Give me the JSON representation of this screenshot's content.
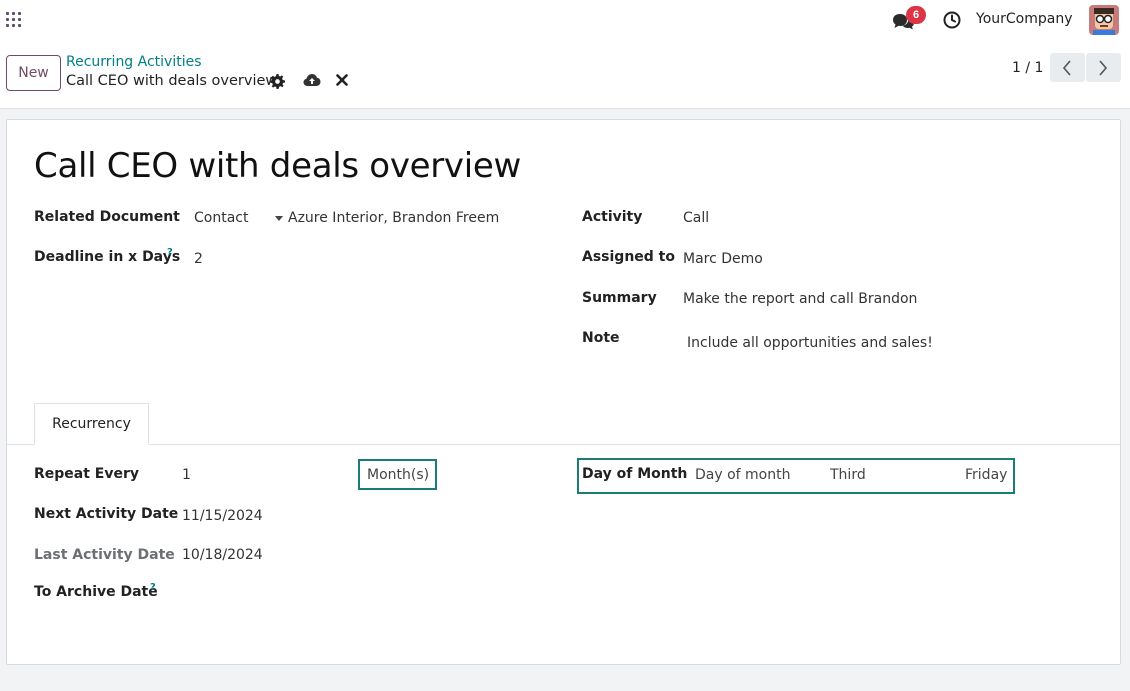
{
  "header": {
    "notification_count": "6",
    "company": "YourCompany"
  },
  "controls": {
    "new_label": "New",
    "breadcrumb": "Recurring Activities",
    "record_name": "Call CEO with deals overview",
    "pager": "1 / 1"
  },
  "form": {
    "title": "Call CEO with deals overview",
    "related_document_label": "Related Document",
    "related_model": "Contact",
    "related_record": "Azure Interior, Brandon Freem",
    "deadline_label": "Deadline in x Days",
    "deadline_help": "?",
    "deadline_value": "2",
    "activity_label": "Activity",
    "activity_value": "Call",
    "assigned_label": "Assigned to",
    "assigned_value": "Marc Demo",
    "summary_label": "Summary",
    "summary_value": "Make the report and call Brandon",
    "note_label": "Note",
    "note_value": "Include all opportunities and sales!"
  },
  "tabs": {
    "recurrency": "Recurrency"
  },
  "recurrency": {
    "repeat_every_label": "Repeat Every",
    "repeat_every_value": "1",
    "repeat_unit": "Month(s)",
    "next_date_label": "Next Activity Date",
    "next_date_value": "11/15/2024",
    "last_date_label": "Last Activity Date",
    "last_date_value": "10/18/2024",
    "archive_label": "To Archive Date",
    "archive_help": "?",
    "day_of_month_label": "Day of Month",
    "day_of_month_mode": "Day of month",
    "week_ordinal": "Third",
    "weekday": "Friday"
  },
  "colors": {
    "brand": "#714b67",
    "link": "#017e84",
    "highlight_border": "#1d7b75",
    "badge": "#dc3545"
  }
}
